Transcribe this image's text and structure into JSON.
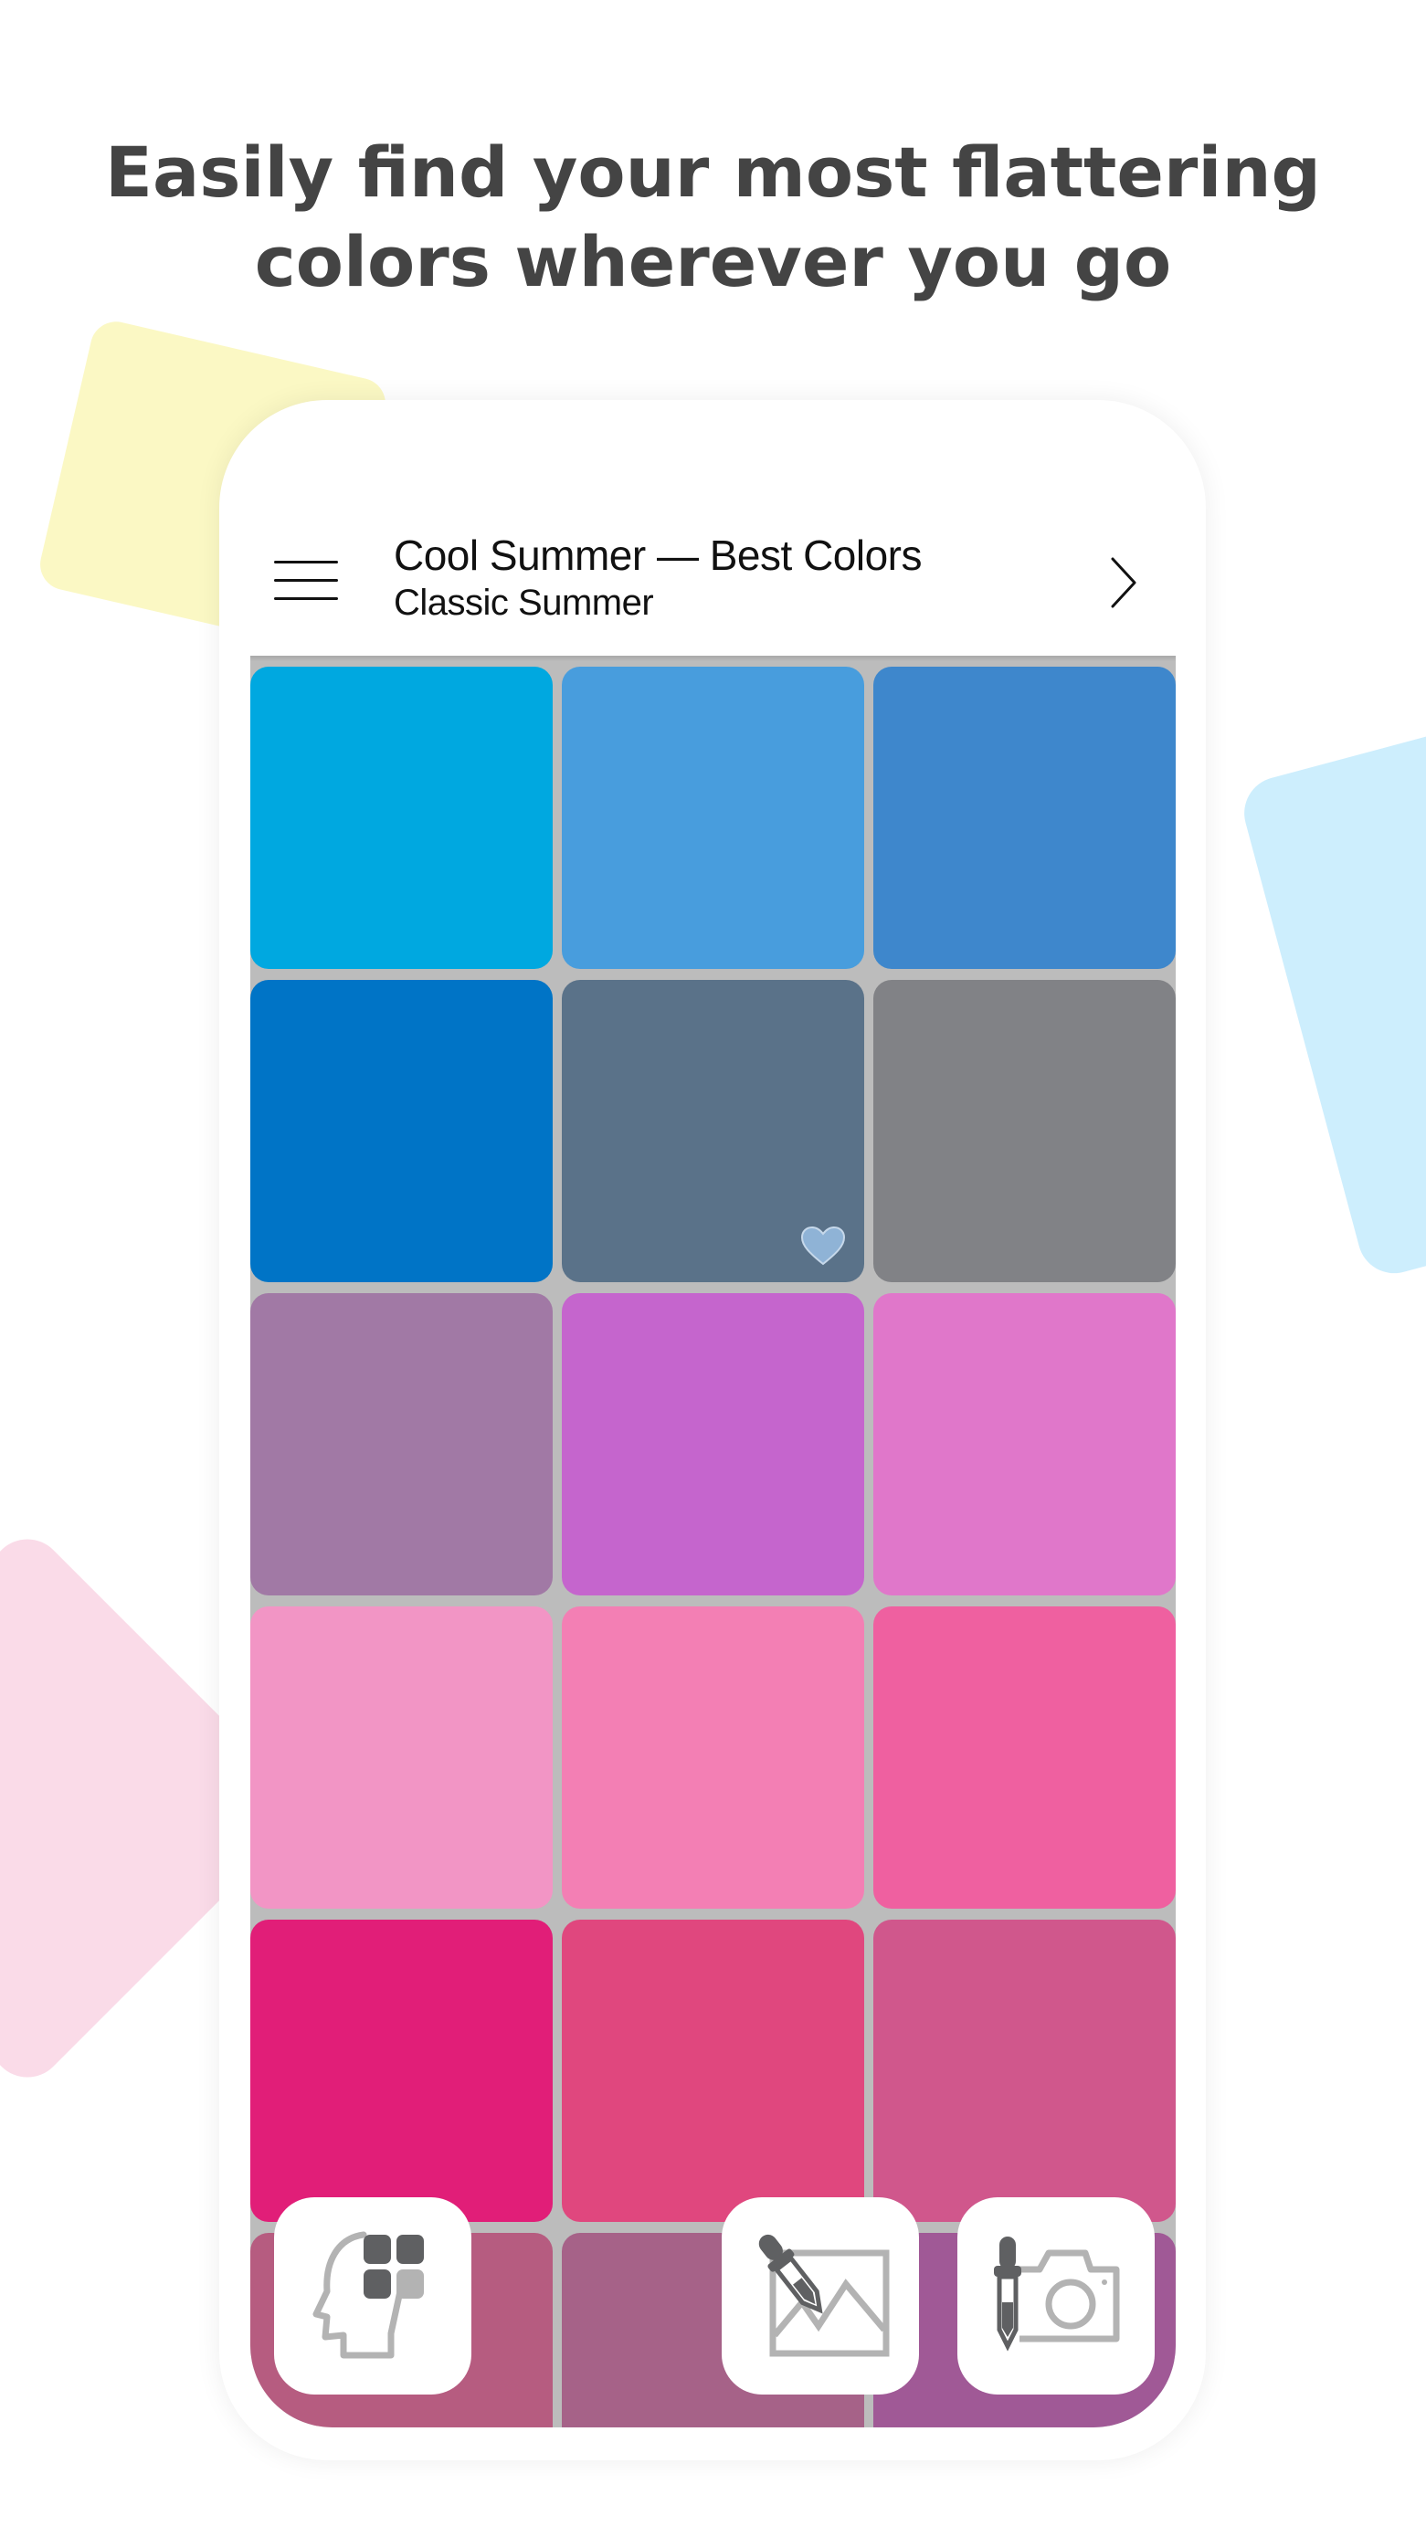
{
  "headline": {
    "line1": "Easily find your most flattering",
    "line2": "colors wherever you go"
  },
  "decorations": {
    "yellow": "#fbf8c4",
    "blue": "#cdeefd",
    "pink": "#fadbe8"
  },
  "app": {
    "header": {
      "menu_icon": "hamburger-menu-icon",
      "title": "Cool Summer — Best Colors",
      "subtitle": "Classic Summer",
      "next_icon": "chevron-right-icon"
    },
    "grid_background": "#bcbcbc",
    "swatches": [
      {
        "color": "#00a8e0",
        "favorite": false
      },
      {
        "color": "#489ddd",
        "favorite": false
      },
      {
        "color": "#3e87cc",
        "favorite": false
      },
      {
        "color": "#0074c6",
        "favorite": false
      },
      {
        "color": "#5a7289",
        "favorite": true
      },
      {
        "color": "#818286",
        "favorite": false
      },
      {
        "color": "#a179a5",
        "favorite": false
      },
      {
        "color": "#c565cd",
        "favorite": false
      },
      {
        "color": "#e077ca",
        "favorite": false
      },
      {
        "color": "#f295c5",
        "favorite": false
      },
      {
        "color": "#f37fb4",
        "favorite": false
      },
      {
        "color": "#ef60a0",
        "favorite": false
      },
      {
        "color": "#e11e78",
        "favorite": false
      },
      {
        "color": "#e0477e",
        "favorite": false
      },
      {
        "color": "#d0578c",
        "favorite": false
      },
      {
        "color": "#b65c80",
        "favorite": false
      },
      {
        "color": "#a66288",
        "favorite": false
      },
      {
        "color": "#a05996",
        "favorite": false
      }
    ],
    "heart_color": "#8fb3d6",
    "actions": [
      {
        "name": "personal-palette-button",
        "icon": "head-palette-icon"
      },
      {
        "name": "pick-from-image-button",
        "icon": "eyedropper-image-icon"
      },
      {
        "name": "pick-from-camera-button",
        "icon": "eyedropper-camera-icon"
      }
    ]
  }
}
